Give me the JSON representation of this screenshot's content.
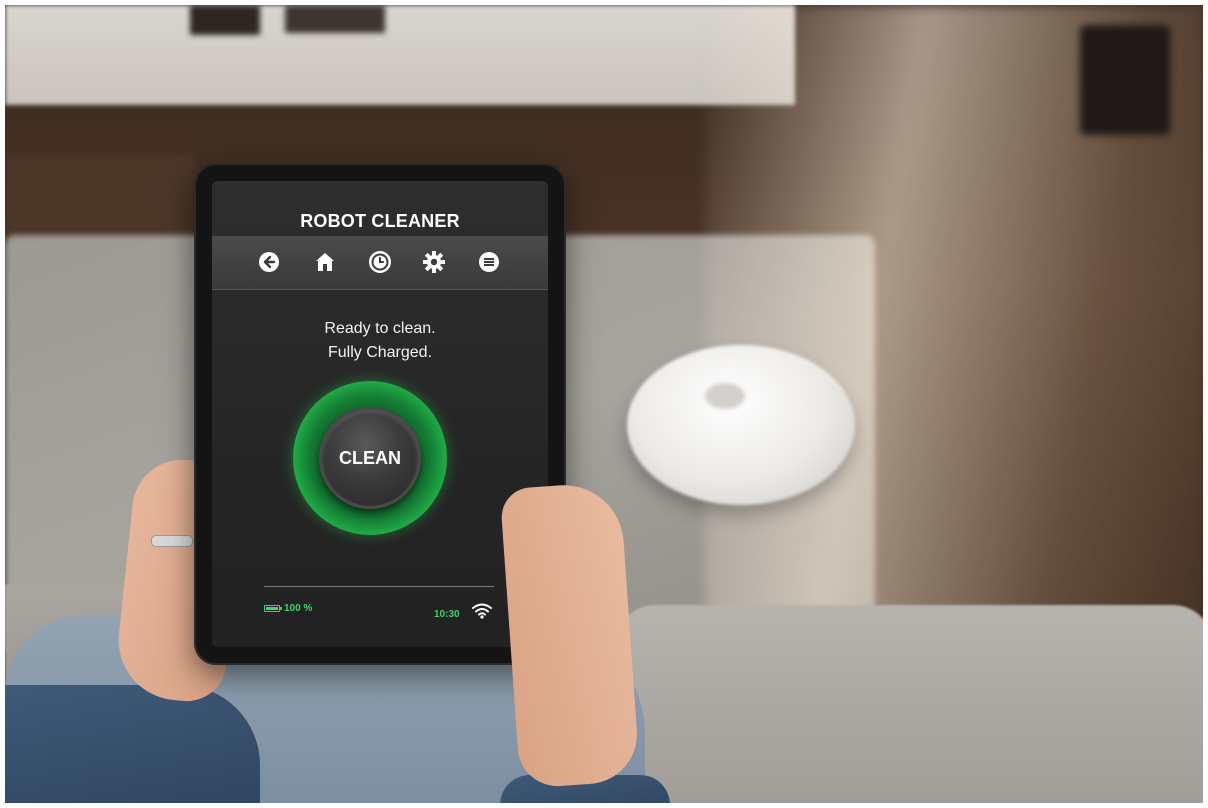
{
  "app": {
    "title": "ROBOT CLEANER"
  },
  "toolbar": {
    "icons": [
      "back-icon",
      "home-icon",
      "clock-icon",
      "gear-icon",
      "menu-icon"
    ]
  },
  "status": {
    "line1": "Ready to clean.",
    "line2": "Fully Charged."
  },
  "clean_button": {
    "label": "CLEAN"
  },
  "footer": {
    "battery_text": "100 %",
    "time": "10:30"
  },
  "colors": {
    "accent_green": "#26c24f",
    "screen_bg": "#2a2a2a",
    "text": "#ffffff"
  }
}
